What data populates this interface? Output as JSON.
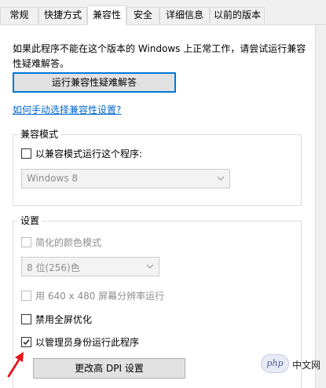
{
  "tabs": [
    "常规",
    "快捷方式",
    "兼容性",
    "安全",
    "详细信息",
    "以前的版本"
  ],
  "active_tab": "兼容性",
  "description": "如果此程序不能在这个版本的 Windows 上正常工作，请尝试运行兼容性疑难解答。",
  "troubleshooter_button": "运行兼容性疑难解答",
  "manual_link": "如何手动选择兼容性设置?",
  "compat_mode": {
    "title": "兼容模式",
    "checkbox_label": "以兼容模式运行这个程序:",
    "checked": false,
    "dropdown_value": "Windows 8"
  },
  "settings": {
    "title": "设置",
    "reduced_color_label": "简化的颜色模式",
    "reduced_color_checked": false,
    "color_dropdown_value": "8 位(256)色",
    "resolution_label": "用 640 x 480 屏幕分辨率运行",
    "resolution_checked": false,
    "fullscreen_label": "禁用全屏优化",
    "fullscreen_checked": false,
    "admin_label": "以管理员身份运行此程序",
    "admin_checked": true,
    "dpi_button": "更改高 DPI 设置"
  },
  "watermark": {
    "logo_text": "php",
    "site_text": "中文网"
  },
  "colors": {
    "accent": "#0078d7",
    "link": "#0066cc",
    "annotation_arrow": "#e8131b"
  }
}
